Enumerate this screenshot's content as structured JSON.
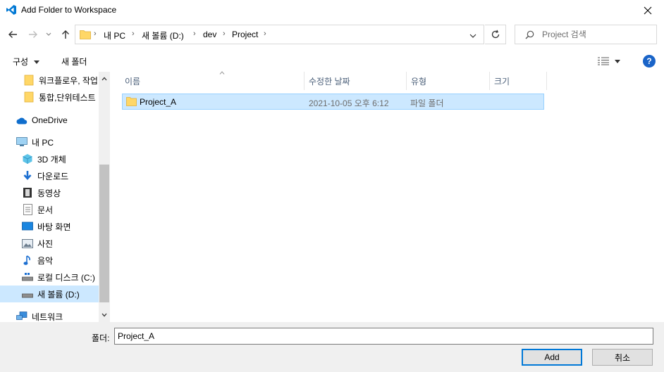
{
  "window": {
    "title": "Add Folder to Workspace",
    "colors": {
      "vscode_blue": "#0078d4",
      "accent": "#0078d7",
      "selection": "#cce8ff"
    }
  },
  "nav": {
    "breadcrumbs": [
      "내 PC",
      "새 볼륨 (D:)",
      "dev",
      "Project"
    ],
    "search_placeholder": "Project 검색"
  },
  "toolbar": {
    "organize_label": "구성",
    "new_folder_label": "새 폴더"
  },
  "sidebar": {
    "items": [
      {
        "label": "워크플로우, 작업",
        "icon": "folder-icon"
      },
      {
        "label": "통합,단위테스트",
        "icon": "folder-icon"
      },
      {
        "label": "OneDrive",
        "icon": "cloud-icon"
      },
      {
        "label": "내 PC",
        "icon": "computer-icon"
      },
      {
        "label": "3D 개체",
        "icon": "cube-icon"
      },
      {
        "label": "다운로드",
        "icon": "download-icon"
      },
      {
        "label": "동영상",
        "icon": "film-icon"
      },
      {
        "label": "문서",
        "icon": "document-icon"
      },
      {
        "label": "바탕 화면",
        "icon": "desktop-icon"
      },
      {
        "label": "사진",
        "icon": "picture-icon"
      },
      {
        "label": "음악",
        "icon": "music-icon"
      },
      {
        "label": "로컬 디스크 (C:)",
        "icon": "drive-icon"
      },
      {
        "label": "새 볼륨 (D:)",
        "icon": "drive-icon"
      },
      {
        "label": "네트워크",
        "icon": "network-icon"
      }
    ]
  },
  "content": {
    "columns": [
      "이름",
      "수정한 날짜",
      "유형",
      "크기"
    ],
    "rows": [
      {
        "name": "Project_A",
        "date": "2021-10-05 오후 6:12",
        "type": "파일 폴더",
        "size": ""
      }
    ]
  },
  "bottom": {
    "folder_label": "폴더:",
    "folder_value": "Project_A",
    "add_label": "Add",
    "cancel_label": "취소"
  }
}
